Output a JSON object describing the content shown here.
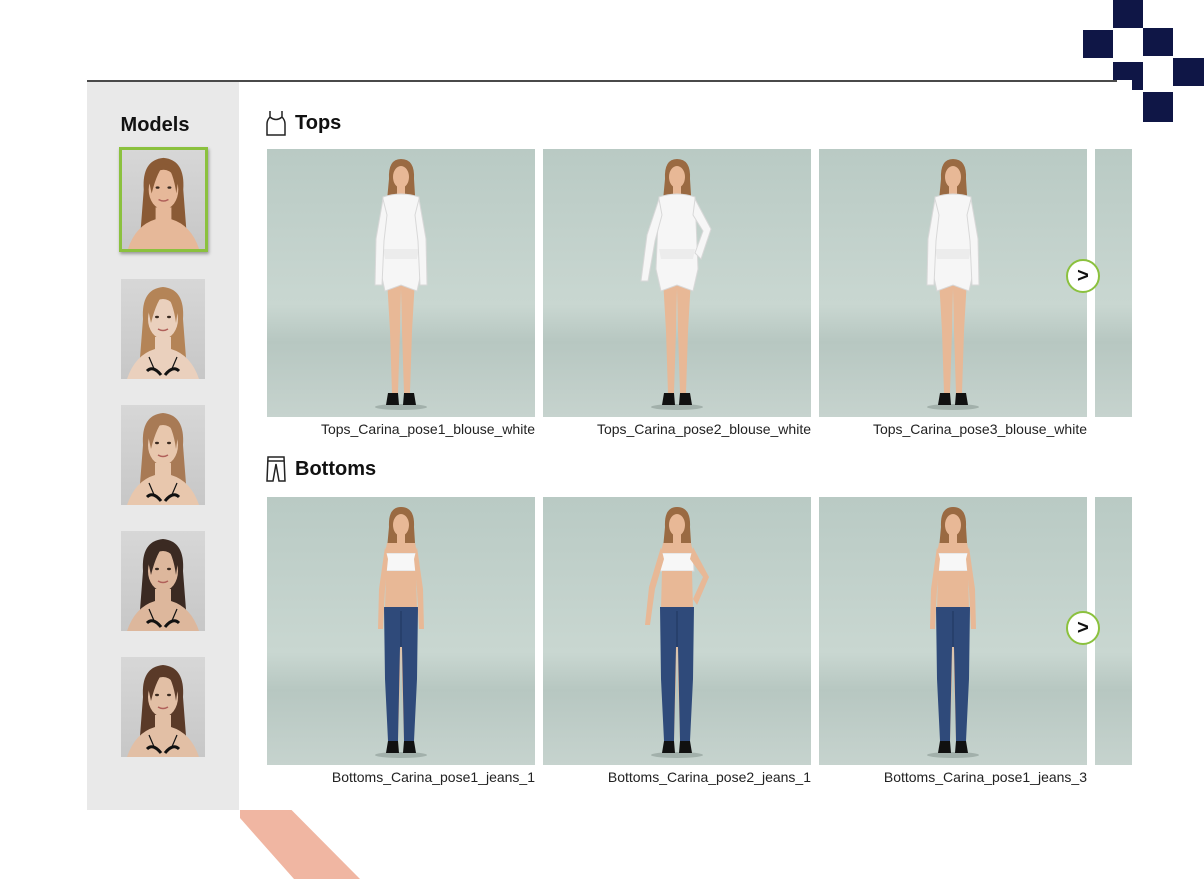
{
  "sidebar": {
    "title": "Models",
    "models": [
      {
        "name": "model-1",
        "selected": true,
        "hair": "#8a5a35",
        "skin": "#e6b899",
        "top": "none"
      },
      {
        "name": "model-2",
        "selected": false,
        "hair": "#b48457",
        "skin": "#ead0bd",
        "top": "bikini"
      },
      {
        "name": "model-3",
        "selected": false,
        "hair": "#a87a55",
        "skin": "#e8c7ad",
        "top": "bikini"
      },
      {
        "name": "model-4",
        "selected": false,
        "hair": "#3b2a22",
        "skin": "#ddb79c",
        "top": "bikini"
      },
      {
        "name": "model-5",
        "selected": false,
        "hair": "#5a3a28",
        "skin": "#e2bfa5",
        "top": "bikini"
      }
    ]
  },
  "sections": {
    "tops": {
      "title": "Tops",
      "icon": "tank-top-icon",
      "items": [
        {
          "label": "Tops_Carina_pose1_blouse_white",
          "pose": "straight",
          "outfit": "blouse"
        },
        {
          "label": "Tops_Carina_pose2_blouse_white",
          "pose": "hand-on-hip",
          "outfit": "blouse"
        },
        {
          "label": "Tops_Carina_pose3_blouse_white",
          "pose": "straight",
          "outfit": "blouse"
        }
      ],
      "next_label": ">"
    },
    "bottoms": {
      "title": "Bottoms",
      "icon": "jeans-icon",
      "items": [
        {
          "label": "Bottoms_Carina_pose1_jeans_1",
          "pose": "straight",
          "outfit": "jeans"
        },
        {
          "label": "Bottoms_Carina_pose2_jeans_1",
          "pose": "hand-on-hip",
          "outfit": "jeans"
        },
        {
          "label": "Bottoms_Carina_pose1_jeans_3",
          "pose": "straight",
          "outfit": "jeans"
        }
      ],
      "next_label": ">"
    }
  },
  "colors": {
    "accent": "#8bc13e",
    "deco_navy": "#0f1646",
    "deco_peach": "#f0b6a2",
    "sidebar_bg": "#e9e9e9",
    "card_bg": "#c2d1cb",
    "denim": "#2f4a7a",
    "blouse": "#f6f6f6"
  }
}
